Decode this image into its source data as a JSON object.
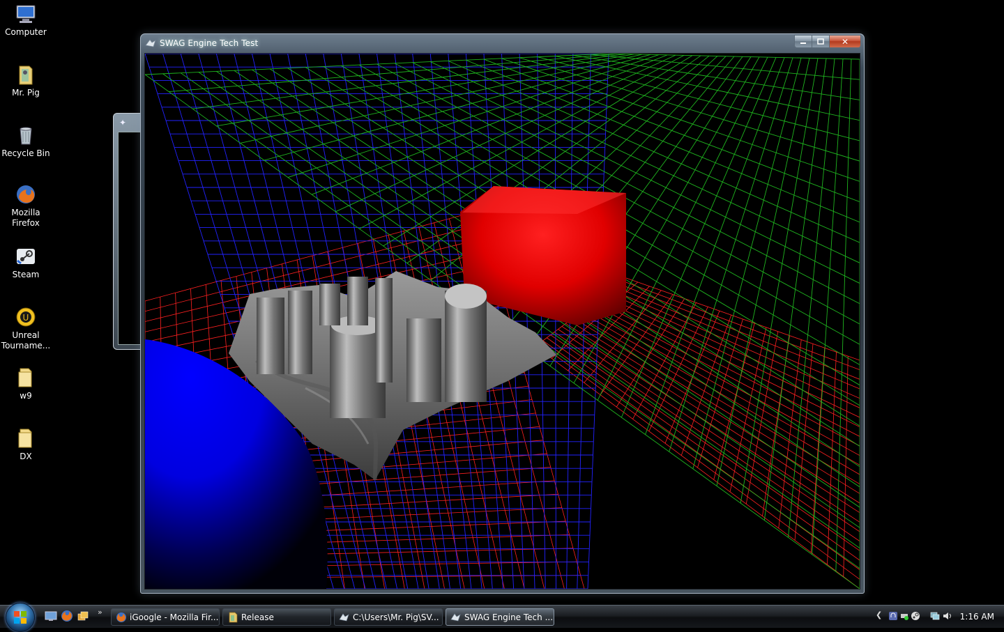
{
  "desktop": {
    "icons": [
      {
        "label": "Computer",
        "icon": "computer-icon"
      },
      {
        "label": "Mr. Pig",
        "icon": "user-folder-icon"
      },
      {
        "label": "Recycle Bin",
        "icon": "recycle-bin-icon"
      },
      {
        "label": "Mozilla Firefox",
        "icon": "firefox-icon"
      },
      {
        "label": "Steam",
        "icon": "steam-icon"
      },
      {
        "label": "Unreal Tourname...",
        "icon": "unreal-tournament-icon"
      },
      {
        "label": "w9",
        "icon": "folder-icon"
      },
      {
        "label": "DX",
        "icon": "folder-icon"
      }
    ]
  },
  "window": {
    "title": "SWAG Engine Tech Test",
    "minimize": "minimize",
    "maximize": "maximize",
    "close": "✕"
  },
  "scene": {
    "background_color": "#000000",
    "grid_colors": {
      "floor": "#ff2020",
      "back_wall": "#2020ff",
      "side_wall": "#20c020"
    },
    "objects": [
      "red-cube",
      "blue-sphere",
      "gray-heightmap-terrain"
    ]
  },
  "taskbar": {
    "start": "Start",
    "quick_launch": [
      "show-desktop-icon",
      "firefox-icon",
      "switch-windows-icon"
    ],
    "buttons": [
      {
        "label": "iGoogle - Mozilla Fir...",
        "icon": "firefox-icon",
        "active": false
      },
      {
        "label": "Release",
        "icon": "folder-icon",
        "active": false
      },
      {
        "label": "C:\\Users\\Mr. Pig\\SV...",
        "icon": "app-icon",
        "active": false
      },
      {
        "label": "SWAG Engine Tech ...",
        "icon": "app-icon",
        "active": true
      }
    ],
    "clock": "1:16 AM"
  }
}
